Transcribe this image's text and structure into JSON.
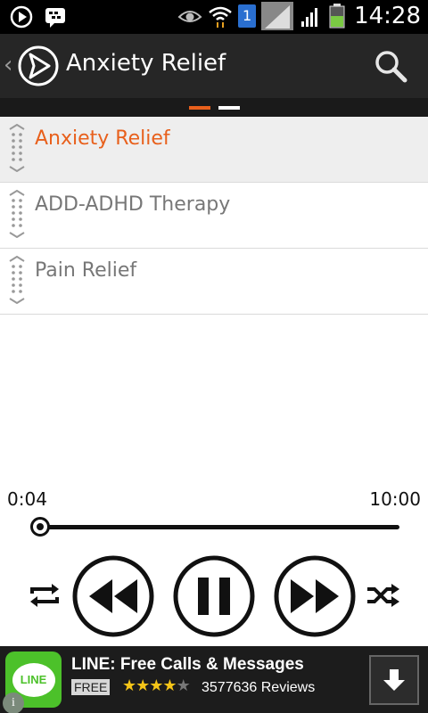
{
  "status_bar": {
    "time": "14:28",
    "sim_badge": "1",
    "icons": [
      "play-circle-icon",
      "bbm-icon",
      "eye-icon",
      "wifi-icon",
      "sim-icon",
      "signal-icon",
      "signal-icon",
      "battery-icon"
    ]
  },
  "action_bar": {
    "back_glyph": "‹",
    "title": "Anxiety Relief",
    "search_icon": "search-icon"
  },
  "pager": {
    "pages": 2,
    "active_index": 0
  },
  "playlist": {
    "items": [
      {
        "label": "Anxiety Relief",
        "selected": true
      },
      {
        "label": "ADD-ADHD Therapy",
        "selected": false
      },
      {
        "label": "Pain Relief",
        "selected": false
      }
    ]
  },
  "player": {
    "elapsed": "0:04",
    "total": "10:00",
    "progress": 0.0067,
    "controls": [
      "repeat-icon",
      "rewind-icon",
      "pause-icon",
      "fast-forward-icon",
      "shuffle-icon"
    ]
  },
  "ad": {
    "app_logo_text": "LINE",
    "title": "LINE: Free Calls & Messages",
    "price_badge": "FREE",
    "rating": 4,
    "rating_max": 5,
    "reviews": "3577636 Reviews",
    "info_glyph": "i"
  },
  "colors": {
    "accent": "#e8601c",
    "action_bar_bg": "#262626",
    "status_bar_bg": "#000000",
    "ad_green": "#4cc12a",
    "star": "#f5c518"
  }
}
